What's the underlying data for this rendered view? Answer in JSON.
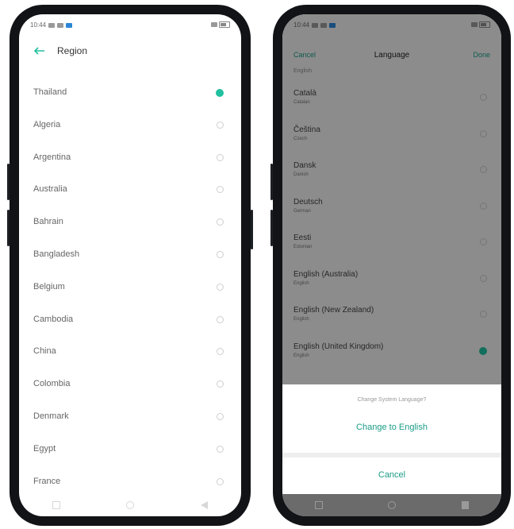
{
  "left_phone": {
    "status": {
      "time": "10:44"
    },
    "header": {
      "title": "Region"
    },
    "regions": [
      {
        "label": "Thailand",
        "selected": true
      },
      {
        "label": "Algeria",
        "selected": false
      },
      {
        "label": "Argentina",
        "selected": false
      },
      {
        "label": "Australia",
        "selected": false
      },
      {
        "label": "Bahrain",
        "selected": false
      },
      {
        "label": "Bangladesh",
        "selected": false
      },
      {
        "label": "Belgium",
        "selected": false
      },
      {
        "label": "Cambodia",
        "selected": false
      },
      {
        "label": "China",
        "selected": false
      },
      {
        "label": "Colombia",
        "selected": false
      },
      {
        "label": "Denmark",
        "selected": false
      },
      {
        "label": "Egypt",
        "selected": false
      },
      {
        "label": "France",
        "selected": false
      }
    ]
  },
  "right_phone": {
    "status": {
      "time": "10:44"
    },
    "header": {
      "cancel": "Cancel",
      "title": "Language",
      "done": "Done"
    },
    "partial_item": "English",
    "languages": [
      {
        "name": "Català",
        "native": "Catalan",
        "selected": false
      },
      {
        "name": "Čeština",
        "native": "Czech",
        "selected": false
      },
      {
        "name": "Dansk",
        "native": "Danish",
        "selected": false
      },
      {
        "name": "Deutsch",
        "native": "German",
        "selected": false
      },
      {
        "name": "Eesti",
        "native": "Estonian",
        "selected": false
      },
      {
        "name": "English (Australia)",
        "native": "English",
        "selected": false
      },
      {
        "name": "English (New Zealand)",
        "native": "English",
        "selected": false
      },
      {
        "name": "English (United Kingdom)",
        "native": "English",
        "selected": true
      }
    ],
    "sheet": {
      "prompt": "Change System Language?",
      "action": "Change to English",
      "cancel": "Cancel"
    }
  },
  "colors": {
    "accent": "#1a9c86",
    "radio_checked": "#20c0a0"
  }
}
